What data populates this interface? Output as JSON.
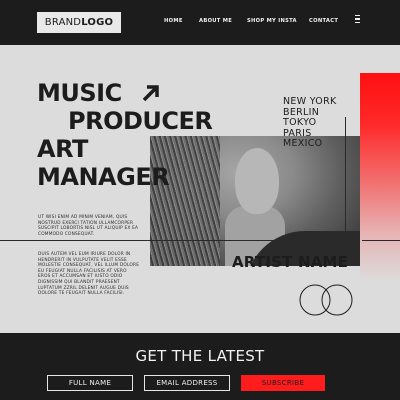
{
  "header": {
    "logo_part1": "BRAND",
    "logo_part2": "LOGO",
    "nav": [
      "HOME",
      "ABOUT ME",
      "SHOP MY INSTA",
      "CONTACT"
    ]
  },
  "hero": {
    "title_lines": [
      "MUSIC",
      "PRODUCER",
      "ART",
      "MANAGER"
    ],
    "cities": [
      "NEW YORK",
      "BERLIN",
      "TOKYO",
      "PARIS",
      "MEXICO"
    ],
    "paragraph1": [
      "UT WISI ENIM AD MINIM VENIAM, QUIS",
      "NOSTRUD EXERCI TATION ULLAMCORPER",
      "SUSCIPIT LOBORTIS NISL UT ALIQUIP EX EA",
      "COMMODO CONSEQUAT."
    ],
    "paragraph2": [
      "DUIS AUTEM VEL EUM IRIURE DOLOR IN",
      "HENDRERIT IN VULPUTATE VELIT ESSE",
      "MOLESTIE CONSEQUAT, VEL ILLUM DOLORE",
      "EU FEUGIAT NULLA FACILISIS AT VERO",
      "EROS ET ACCUMSAN ET IUSTO ODIO",
      "DIGNISSIM QUI BLANDIT PRAESENT",
      "LUPTATUM ZZRIL DELENIT AUGUE DUIS",
      "DOLORE TE FEUGAIT NULLA FACILISI."
    ],
    "artist_name": "ARTIST NAME"
  },
  "footer": {
    "heading": "GET THE LATEST",
    "full_name": "FULL NAME",
    "email": "EMAIL ADDRESS",
    "subscribe": "SUBSCRIBE"
  },
  "colors": {
    "dark": "#1c1c1c",
    "light": "#dcdcdc",
    "accent": "#ff1c1c"
  },
  "icons": {
    "menu": "hamburger-menu-icon",
    "arrow": "arrow-up-right-icon",
    "circles": "interlocking-circles-icon"
  }
}
